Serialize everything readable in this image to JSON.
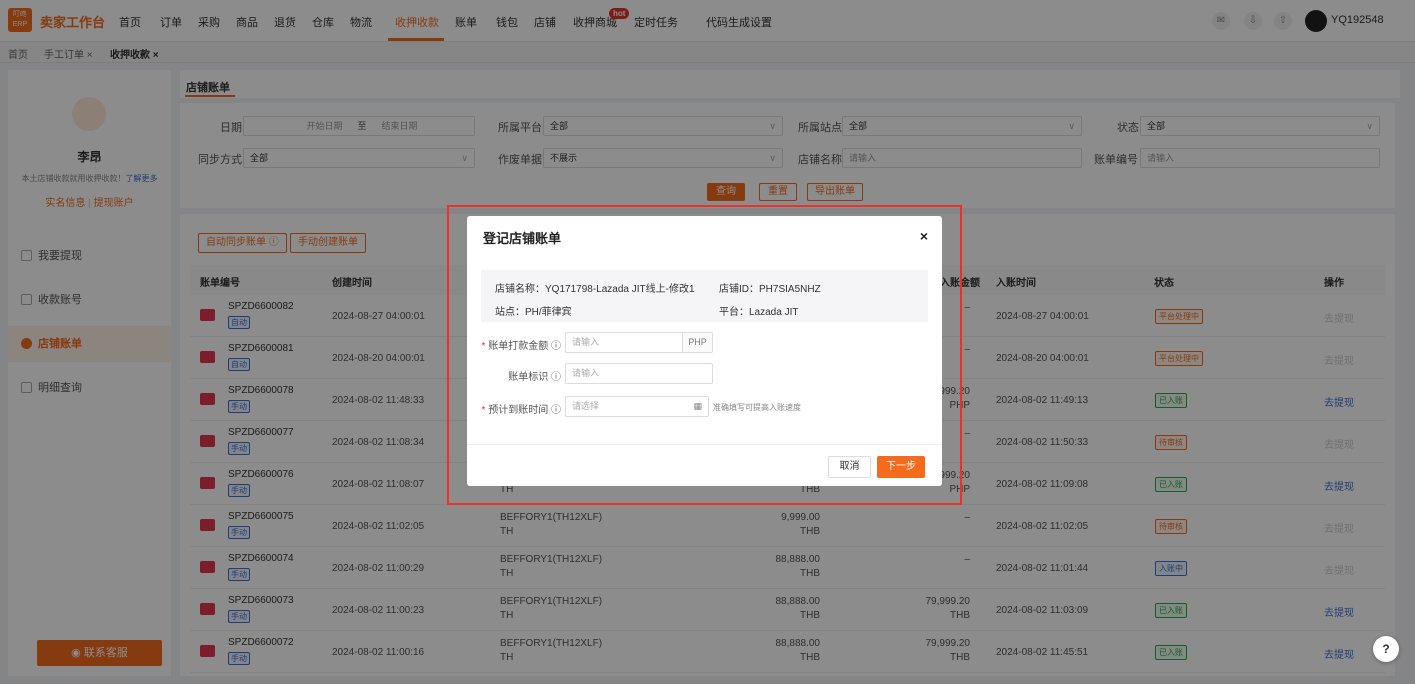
{
  "topnav": {
    "logo_text": "叮咚ERP",
    "brand": "卖家工作台",
    "items": [
      "首页",
      "订单",
      "采购",
      "商品",
      "退货",
      "仓库",
      "物流",
      "收押收款",
      "账单",
      "钱包",
      "店铺",
      "收押商城",
      "定时任务",
      "代码生成",
      "设置"
    ],
    "hot_badge": "hot",
    "username": "YQ192548"
  },
  "tabs": [
    "首页",
    "手工订单 ×",
    "收押收款 ×"
  ],
  "sidebar": {
    "name": "李昂",
    "desc": "本土店铺收款就用收押收款！",
    "desc_link": "了解更多",
    "link1": "实名信息",
    "link2": "提现账户",
    "items": [
      "我要提现",
      "收款账号",
      "店铺账单",
      "明细查询"
    ],
    "contact": "联系客服"
  },
  "page_title": "店铺账单",
  "filters": {
    "date_label": "日期",
    "date_start": "开始日期",
    "date_sep": "至",
    "date_end": "结束日期",
    "platform_label": "所属平台",
    "platform_value": "全部",
    "site_label": "所属站点",
    "site_value": "全部",
    "status_label": "状态",
    "status_value": "全部",
    "sync_label": "同步方式",
    "sync_value": "全部",
    "void_label": "作废单据",
    "void_value": "不展示",
    "store_label": "店铺名称",
    "store_placeholder": "请输入",
    "bill_label": "账单编号",
    "bill_placeholder": "请输入",
    "query": "查询",
    "reset": "重置",
    "export": "导出账单"
  },
  "table": {
    "auto_sync": "自动同步账单 ⓘ",
    "manual_create": "手动创建账单",
    "headers": [
      "账单编号",
      "创建时间",
      "入账金额",
      "入账时间",
      "状态",
      "操作"
    ],
    "rows": [
      {
        "code": "SPZD6600082",
        "tag": "自动",
        "ctime": "2024-08-27 04:00:01",
        "store": "",
        "region": "",
        "amt": "",
        "cur": "",
        "in_amt": "–",
        "in_cur": "",
        "in_time": "2024-08-27 04:00:01",
        "status": "平台处理中",
        "status_color": "orange",
        "op": "去提现",
        "op_enabled": false
      },
      {
        "code": "SPZD6600081",
        "tag": "自动",
        "ctime": "2024-08-20 04:00:01",
        "store": "",
        "region": "",
        "amt": "",
        "cur": "",
        "in_amt": "–",
        "in_cur": "",
        "in_time": "2024-08-20 04:00:01",
        "status": "平台处理中",
        "status_color": "orange",
        "op": "去提现",
        "op_enabled": false
      },
      {
        "code": "SPZD6600078",
        "tag": "手动",
        "ctime": "2024-08-02 11:48:33",
        "store": "",
        "region": "",
        "amt": "",
        "cur": "",
        "in_amt": "79,999.20",
        "in_cur": "PHP",
        "in_time": "2024-08-02 11:49:13",
        "status": "已入账",
        "status_color": "green",
        "op": "去提现",
        "op_enabled": true
      },
      {
        "code": "SPZD6600077",
        "tag": "手动",
        "ctime": "2024-08-02 11:08:34",
        "store": "",
        "region": "",
        "amt": "",
        "cur": "",
        "in_amt": "–",
        "in_cur": "",
        "in_time": "2024-08-02 11:50:33",
        "status": "待审核",
        "status_color": "orange",
        "op": "去提现",
        "op_enabled": false
      },
      {
        "code": "SPZD6600076",
        "tag": "手动",
        "ctime": "2024-08-02 11:08:07",
        "store": "",
        "region": "TH",
        "amt": "",
        "cur": "THB",
        "in_amt": "79,999.20",
        "in_cur": "PHP",
        "in_time": "2024-08-02 11:09:08",
        "status": "已入账",
        "status_color": "green",
        "op": "去提现",
        "op_enabled": true
      },
      {
        "code": "SPZD6600075",
        "tag": "手动",
        "ctime": "2024-08-02 11:02:05",
        "store": "BEFFORY1(TH12XLF)",
        "region": "TH",
        "amt": "9,999.00",
        "cur": "THB",
        "in_amt": "–",
        "in_cur": "",
        "in_time": "2024-08-02 11:02:05",
        "status": "待审核",
        "status_color": "orange",
        "op": "去提现",
        "op_enabled": false
      },
      {
        "code": "SPZD6600074",
        "tag": "手动",
        "ctime": "2024-08-02 11:00:29",
        "store": "BEFFORY1(TH12XLF)",
        "region": "TH",
        "amt": "88,888.00",
        "cur": "THB",
        "in_amt": "–",
        "in_cur": "",
        "in_time": "2024-08-02 11:01:44",
        "status": "入账中",
        "status_color": "blue",
        "op": "去提现",
        "op_enabled": false
      },
      {
        "code": "SPZD6600073",
        "tag": "手动",
        "ctime": "2024-08-02 11:00:23",
        "store": "BEFFORY1(TH12XLF)",
        "region": "TH",
        "amt": "88,888.00",
        "cur": "THB",
        "in_amt": "79,999.20",
        "in_cur": "THB",
        "in_time": "2024-08-02 11:03:09",
        "status": "已入账",
        "status_color": "green",
        "op": "去提现",
        "op_enabled": true
      },
      {
        "code": "SPZD6600072",
        "tag": "手动",
        "ctime": "2024-08-02 11:00:16",
        "store": "BEFFORY1(TH12XLF)",
        "region": "TH",
        "amt": "88,888.00",
        "cur": "THB",
        "in_amt": "79,999.20",
        "in_cur": "THB",
        "in_time": "2024-08-02 11:45:51",
        "status": "已入账",
        "status_color": "green",
        "op": "去提现",
        "op_enabled": true
      }
    ]
  },
  "modal": {
    "title": "登记店铺账单",
    "close": "×",
    "store_name": "店铺名称：YQ171798-Lazada JIT线上-修改1",
    "store_id": "店铺ID：PH7SIA5NHZ",
    "site": "站点：PH/菲律宾",
    "platform": "平台：Lazada JIT",
    "amount_label": "账单打款金额",
    "amount_placeholder": "请输入",
    "amount_unit": "PHP",
    "mark_label": "账单标识",
    "mark_placeholder": "请输入",
    "eta_label": "预计到账时间",
    "eta_placeholder": "请选择",
    "eta_hint": "准确填写可提高入账速度",
    "cancel": "取消",
    "next": "下一步"
  },
  "help": "?"
}
